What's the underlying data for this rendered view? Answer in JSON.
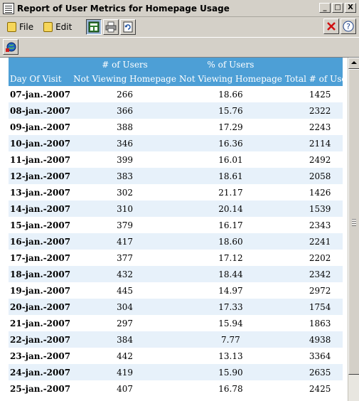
{
  "window": {
    "title": "Report of User Metrics for Homepage Usage",
    "icon": "report-icon",
    "controls": [
      "_",
      "□",
      "X"
    ]
  },
  "menu": {
    "items": [
      {
        "label": "File",
        "icon": "file-icon"
      },
      {
        "label": "Edit",
        "icon": "edit-icon"
      }
    ],
    "toolbar_icons": [
      "report-view-icon",
      "print-icon",
      "refresh-icon"
    ],
    "right_icons": [
      "close-red-icon",
      "help-icon"
    ]
  },
  "toolbar2": {
    "icons": [
      "globe-icon"
    ]
  },
  "report": {
    "columns": [
      {
        "line1": "",
        "line2": "Day Of Visit"
      },
      {
        "line1": "# of Users",
        "line2": "Not Viewing Homepage"
      },
      {
        "line1": "% of Users",
        "line2": "Not Viewing Homepage"
      },
      {
        "line1": "",
        "line2": "Total # of Users"
      }
    ],
    "rows": [
      [
        "07-jan.-2007",
        "266",
        "18.66",
        "1425"
      ],
      [
        "08-jan.-2007",
        "366",
        "15.76",
        "2322"
      ],
      [
        "09-jan.-2007",
        "388",
        "17.29",
        "2243"
      ],
      [
        "10-jan.-2007",
        "346",
        "16.36",
        "2114"
      ],
      [
        "11-jan.-2007",
        "399",
        "16.01",
        "2492"
      ],
      [
        "12-jan.-2007",
        "383",
        "18.61",
        "2058"
      ],
      [
        "13-jan.-2007",
        "302",
        "21.17",
        "1426"
      ],
      [
        "14-jan.-2007",
        "310",
        "20.14",
        "1539"
      ],
      [
        "15-jan.-2007",
        "379",
        "16.17",
        "2343"
      ],
      [
        "16-jan.-2007",
        "417",
        "18.60",
        "2241"
      ],
      [
        "17-jan.-2007",
        "377",
        "17.12",
        "2202"
      ],
      [
        "18-jan.-2007",
        "432",
        "18.44",
        "2342"
      ],
      [
        "19-jan.-2007",
        "445",
        "14.97",
        "2972"
      ],
      [
        "20-jan.-2007",
        "304",
        "17.33",
        "1754"
      ],
      [
        "21-jan.-2007",
        "297",
        "15.94",
        "1863"
      ],
      [
        "22-jan.-2007",
        "384",
        "7.77",
        "4938"
      ],
      [
        "23-jan.-2007",
        "442",
        "13.13",
        "3364"
      ],
      [
        "24-jan.-2007",
        "419",
        "15.90",
        "2635"
      ],
      [
        "25-jan.-2007",
        "407",
        "16.78",
        "2425"
      ]
    ]
  },
  "colors": {
    "header_bg": "#4d9fd6",
    "alt_row": "#e7f1fa",
    "chrome": "#d4d0c8"
  }
}
